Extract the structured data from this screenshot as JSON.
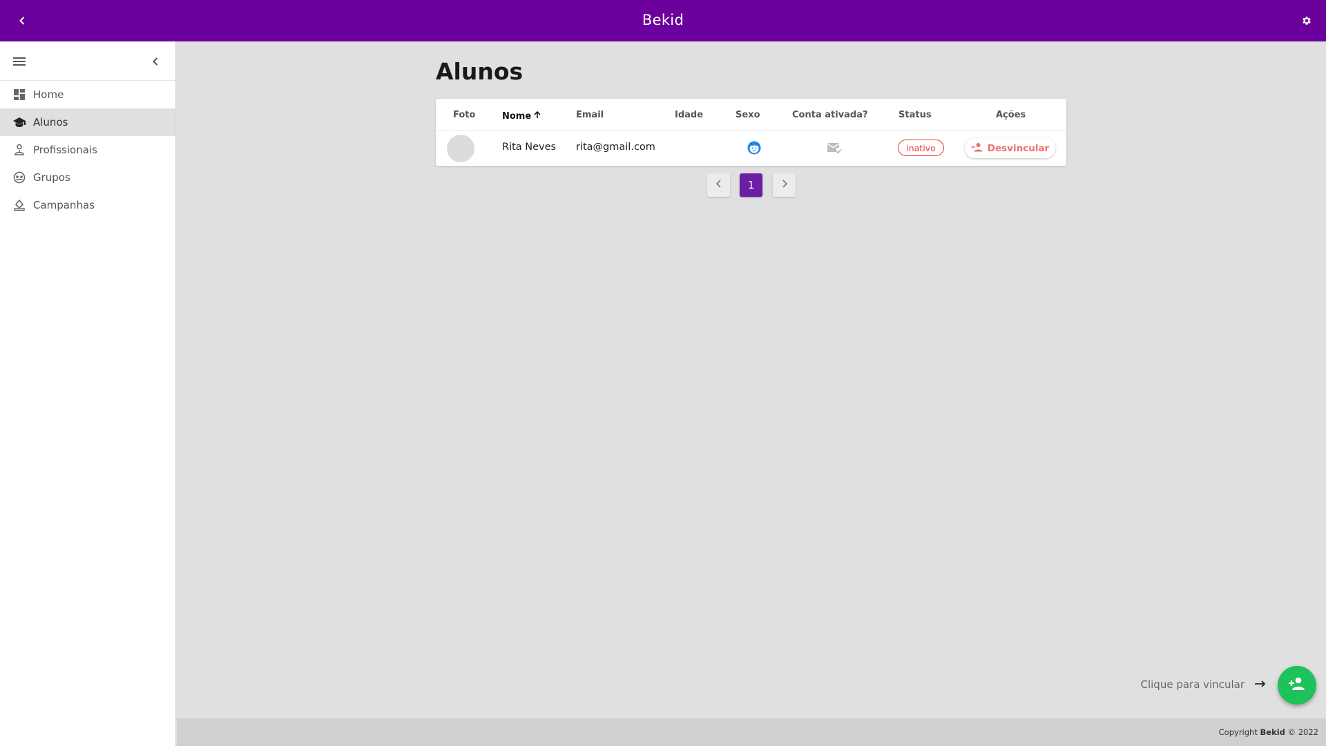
{
  "app": {
    "title": "Bekid"
  },
  "sidebar": {
    "items": [
      {
        "label": "Home",
        "icon": "dashboard-icon",
        "active": false
      },
      {
        "label": "Alunos",
        "icon": "school-icon",
        "active": true
      },
      {
        "label": "Profissionais",
        "icon": "profissionais-icon",
        "active": false
      },
      {
        "label": "Grupos",
        "icon": "groups-icon",
        "active": false
      },
      {
        "label": "Campanhas",
        "icon": "campaign-icon",
        "active": false
      }
    ]
  },
  "main": {
    "title": "Alunos",
    "table": {
      "headers": {
        "foto": "Foto",
        "nome": "Nome",
        "email": "Email",
        "idade": "Idade",
        "sexo": "Sexo",
        "conta": "Conta ativada?",
        "status": "Status",
        "acoes": "Ações"
      },
      "sort": {
        "column": "Nome",
        "direction": "asc"
      },
      "rows": [
        {
          "nome": "Rita Neves",
          "email": "rita@gmail.com",
          "idade": "",
          "sexo_icon": "female-face-icon",
          "conta_icon": "mark-email-read-icon",
          "status": "inativo",
          "action_label": "Desvincular"
        }
      ]
    },
    "pagination": {
      "current": "1"
    },
    "hint": "Clique para vincular"
  },
  "footer": {
    "prefix": "Copyright",
    "brand": "Bekid",
    "suffix": "© 2022"
  },
  "colors": {
    "primary": "#6c009c",
    "pagination_active": "#6c1fa4",
    "fab": "#1ec25a",
    "danger": "#e53935",
    "sexo_icon": "#1e88e5"
  }
}
